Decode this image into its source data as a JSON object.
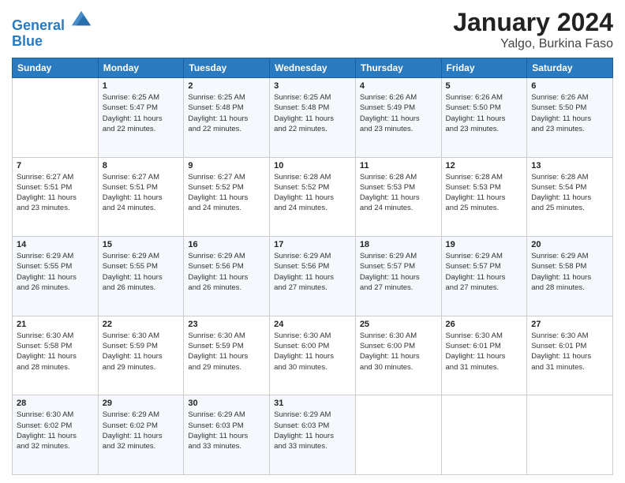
{
  "header": {
    "logo_line1": "General",
    "logo_line2": "Blue",
    "title": "January 2024",
    "subtitle": "Yalgo, Burkina Faso"
  },
  "weekdays": [
    "Sunday",
    "Monday",
    "Tuesday",
    "Wednesday",
    "Thursday",
    "Friday",
    "Saturday"
  ],
  "weeks": [
    [
      {
        "day": "",
        "info": ""
      },
      {
        "day": "1",
        "info": "Sunrise: 6:25 AM\nSunset: 5:47 PM\nDaylight: 11 hours\nand 22 minutes."
      },
      {
        "day": "2",
        "info": "Sunrise: 6:25 AM\nSunset: 5:48 PM\nDaylight: 11 hours\nand 22 minutes."
      },
      {
        "day": "3",
        "info": "Sunrise: 6:25 AM\nSunset: 5:48 PM\nDaylight: 11 hours\nand 22 minutes."
      },
      {
        "day": "4",
        "info": "Sunrise: 6:26 AM\nSunset: 5:49 PM\nDaylight: 11 hours\nand 23 minutes."
      },
      {
        "day": "5",
        "info": "Sunrise: 6:26 AM\nSunset: 5:50 PM\nDaylight: 11 hours\nand 23 minutes."
      },
      {
        "day": "6",
        "info": "Sunrise: 6:26 AM\nSunset: 5:50 PM\nDaylight: 11 hours\nand 23 minutes."
      }
    ],
    [
      {
        "day": "7",
        "info": "Sunrise: 6:27 AM\nSunset: 5:51 PM\nDaylight: 11 hours\nand 23 minutes."
      },
      {
        "day": "8",
        "info": "Sunrise: 6:27 AM\nSunset: 5:51 PM\nDaylight: 11 hours\nand 24 minutes."
      },
      {
        "day": "9",
        "info": "Sunrise: 6:27 AM\nSunset: 5:52 PM\nDaylight: 11 hours\nand 24 minutes."
      },
      {
        "day": "10",
        "info": "Sunrise: 6:28 AM\nSunset: 5:52 PM\nDaylight: 11 hours\nand 24 minutes."
      },
      {
        "day": "11",
        "info": "Sunrise: 6:28 AM\nSunset: 5:53 PM\nDaylight: 11 hours\nand 24 minutes."
      },
      {
        "day": "12",
        "info": "Sunrise: 6:28 AM\nSunset: 5:53 PM\nDaylight: 11 hours\nand 25 minutes."
      },
      {
        "day": "13",
        "info": "Sunrise: 6:28 AM\nSunset: 5:54 PM\nDaylight: 11 hours\nand 25 minutes."
      }
    ],
    [
      {
        "day": "14",
        "info": "Sunrise: 6:29 AM\nSunset: 5:55 PM\nDaylight: 11 hours\nand 26 minutes."
      },
      {
        "day": "15",
        "info": "Sunrise: 6:29 AM\nSunset: 5:55 PM\nDaylight: 11 hours\nand 26 minutes."
      },
      {
        "day": "16",
        "info": "Sunrise: 6:29 AM\nSunset: 5:56 PM\nDaylight: 11 hours\nand 26 minutes."
      },
      {
        "day": "17",
        "info": "Sunrise: 6:29 AM\nSunset: 5:56 PM\nDaylight: 11 hours\nand 27 minutes."
      },
      {
        "day": "18",
        "info": "Sunrise: 6:29 AM\nSunset: 5:57 PM\nDaylight: 11 hours\nand 27 minutes."
      },
      {
        "day": "19",
        "info": "Sunrise: 6:29 AM\nSunset: 5:57 PM\nDaylight: 11 hours\nand 27 minutes."
      },
      {
        "day": "20",
        "info": "Sunrise: 6:29 AM\nSunset: 5:58 PM\nDaylight: 11 hours\nand 28 minutes."
      }
    ],
    [
      {
        "day": "21",
        "info": "Sunrise: 6:30 AM\nSunset: 5:58 PM\nDaylight: 11 hours\nand 28 minutes."
      },
      {
        "day": "22",
        "info": "Sunrise: 6:30 AM\nSunset: 5:59 PM\nDaylight: 11 hours\nand 29 minutes."
      },
      {
        "day": "23",
        "info": "Sunrise: 6:30 AM\nSunset: 5:59 PM\nDaylight: 11 hours\nand 29 minutes."
      },
      {
        "day": "24",
        "info": "Sunrise: 6:30 AM\nSunset: 6:00 PM\nDaylight: 11 hours\nand 30 minutes."
      },
      {
        "day": "25",
        "info": "Sunrise: 6:30 AM\nSunset: 6:00 PM\nDaylight: 11 hours\nand 30 minutes."
      },
      {
        "day": "26",
        "info": "Sunrise: 6:30 AM\nSunset: 6:01 PM\nDaylight: 11 hours\nand 31 minutes."
      },
      {
        "day": "27",
        "info": "Sunrise: 6:30 AM\nSunset: 6:01 PM\nDaylight: 11 hours\nand 31 minutes."
      }
    ],
    [
      {
        "day": "28",
        "info": "Sunrise: 6:30 AM\nSunset: 6:02 PM\nDaylight: 11 hours\nand 32 minutes."
      },
      {
        "day": "29",
        "info": "Sunrise: 6:29 AM\nSunset: 6:02 PM\nDaylight: 11 hours\nand 32 minutes."
      },
      {
        "day": "30",
        "info": "Sunrise: 6:29 AM\nSunset: 6:03 PM\nDaylight: 11 hours\nand 33 minutes."
      },
      {
        "day": "31",
        "info": "Sunrise: 6:29 AM\nSunset: 6:03 PM\nDaylight: 11 hours\nand 33 minutes."
      },
      {
        "day": "",
        "info": ""
      },
      {
        "day": "",
        "info": ""
      },
      {
        "day": "",
        "info": ""
      }
    ]
  ]
}
